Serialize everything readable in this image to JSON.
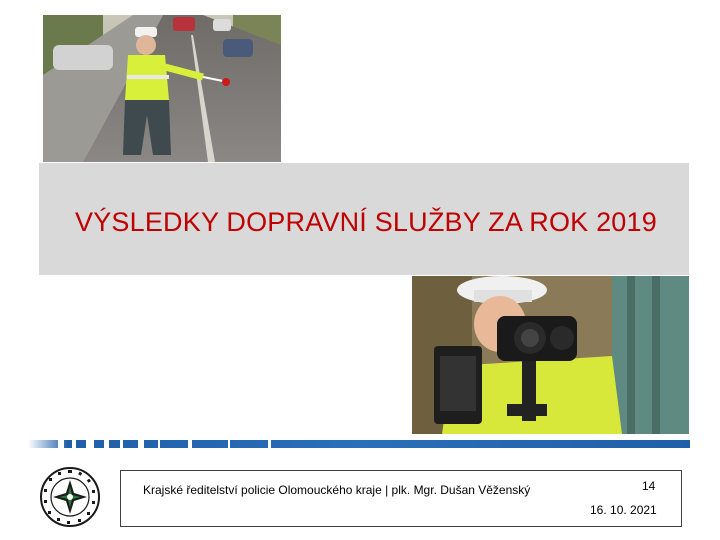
{
  "slide": {
    "title": "VÝSLEDKY DOPRAVNÍ SLUŽBY ZA ROK  2019"
  },
  "footer": {
    "organization": "Krajské ředitelství policie Olomouckého kraje | plk. Mgr. Dušan Věženský",
    "page_number": "14",
    "date": "16. 10. 2021"
  },
  "emblem": {
    "text": "POLICIE ČESKÉ REPUBLIKY",
    "icon": "police-star-emblem-icon"
  },
  "photos": {
    "top": "traffic-officer-photo",
    "bottom": "radar-officer-photo"
  },
  "colors": {
    "title": "#c00000",
    "band": "#d9d9d9",
    "stripe": "#1f5fa8"
  }
}
